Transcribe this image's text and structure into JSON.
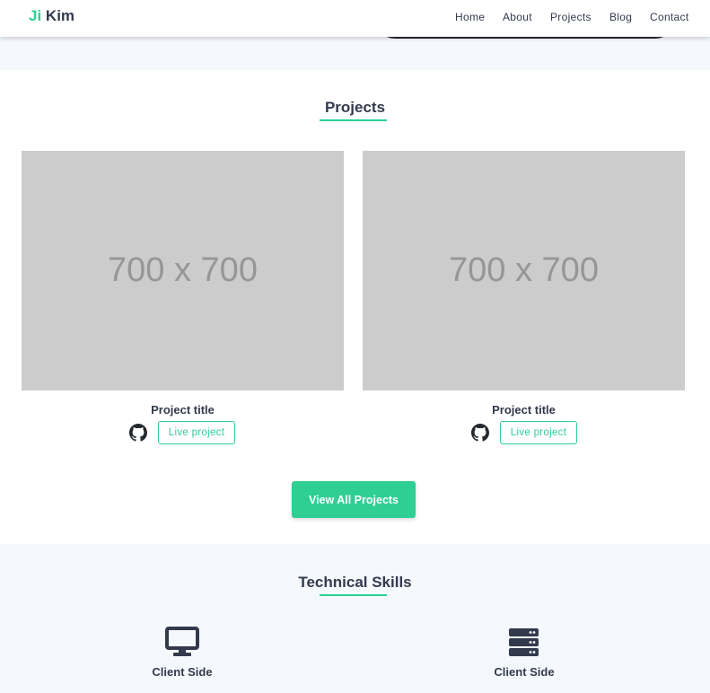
{
  "brand": {
    "first": "Ji",
    "last": "Kim"
  },
  "nav": [
    {
      "label": "Home"
    },
    {
      "label": "About"
    },
    {
      "label": "Projects"
    },
    {
      "label": "Blog"
    },
    {
      "label": "Contact"
    }
  ],
  "projects_section": {
    "title": "Projects",
    "cards": [
      {
        "image_text": "700 x 700",
        "title": "Project title",
        "github_icon": "github-icon",
        "live_label": "Live project"
      },
      {
        "image_text": "700 x 700",
        "title": "Project title",
        "github_icon": "github-icon",
        "live_label": "Live project"
      }
    ],
    "view_all_label": "View All Projects"
  },
  "skills_section": {
    "title": "Technical Skills",
    "items": [
      {
        "icon": "desktop-icon",
        "label": "Client Side"
      },
      {
        "icon": "server-icon",
        "label": "Client Side"
      }
    ]
  },
  "colors": {
    "accent": "#2fcf93",
    "text": "#333a4d",
    "light_bg": "#f5f9fd",
    "placeholder": "#cccccc"
  }
}
